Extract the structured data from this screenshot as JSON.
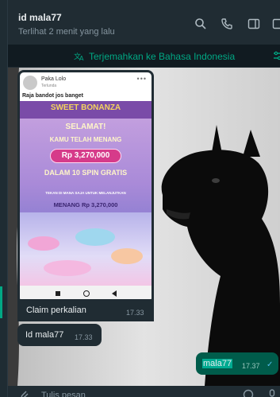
{
  "header": {
    "title": "id mala77",
    "status": "Terlihat 2 menit yang lalu",
    "icons": [
      "search-icon",
      "phone-icon",
      "sidebar-icon",
      "info-icon"
    ]
  },
  "translate": {
    "label": "Terjemahkan ke Bahasa Indonesia",
    "icon": "translate-icon"
  },
  "messages": {
    "image_post": {
      "author": "Paka Lolo",
      "author_sub": "Terlunda",
      "caption": "Raja bandot jos banget",
      "promo": {
        "brand": "SWEET BONANZA",
        "selamat": "SELAMAT!",
        "menang": "KAMU TELAH MENANG",
        "amount": "Rp 3,270,000",
        "spin": "DALAM 10 SPIN GRATIS",
        "tekan": "TEKAN DI MANA SAJA UNTUK MELANJUTKAN",
        "win": "MENANG Rp 3,270,000"
      }
    },
    "claim": {
      "text": "Claim perkalian",
      "time": "17.33"
    },
    "id_msg": {
      "text": "Id mala77",
      "time": "17.33"
    },
    "out_msg": {
      "text": "mala77",
      "time": "17.37"
    }
  },
  "composer": {
    "placeholder": "Tulis pesan"
  },
  "colors": {
    "accent": "#00a884",
    "bubble_in": "#202c33",
    "bubble_out": "#005c4b",
    "header_bg": "#202c33",
    "app_bg": "#111b21"
  }
}
